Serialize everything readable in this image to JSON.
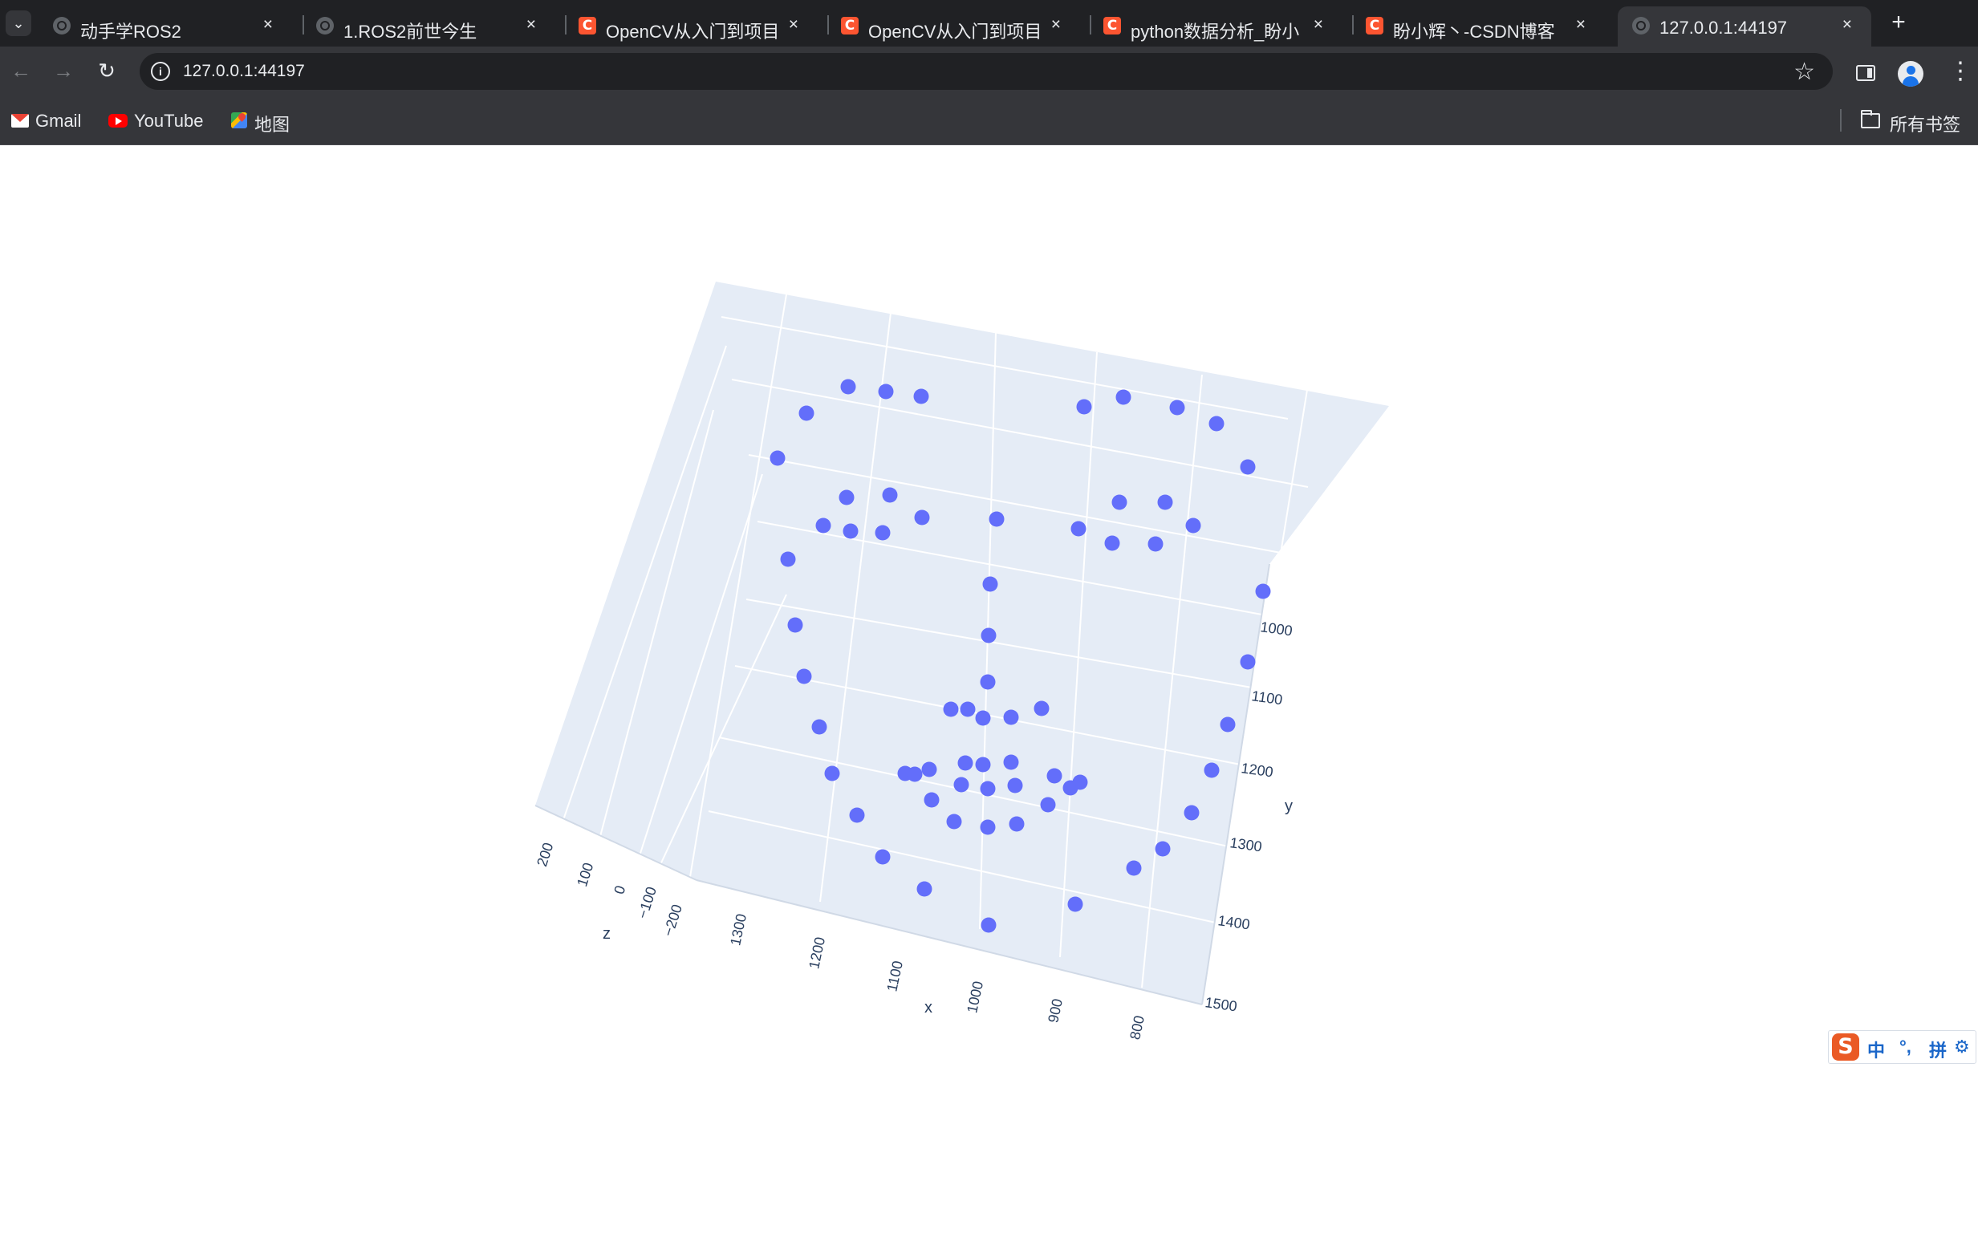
{
  "browser": {
    "tabs": [
      {
        "title": "动手学ROS2",
        "icon": "globe-icon",
        "active": false
      },
      {
        "title": "1.ROS2前世今生",
        "icon": "globe-icon",
        "active": false
      },
      {
        "title": "OpenCV从入门到项目",
        "icon": "csdn-icon",
        "active": false
      },
      {
        "title": "OpenCV从入门到项目",
        "icon": "csdn-icon",
        "active": false
      },
      {
        "title": "python数据分析_盼小",
        "icon": "csdn-icon",
        "active": false
      },
      {
        "title": "盼小辉丶-CSDN博客",
        "icon": "csdn-icon",
        "active": false
      },
      {
        "title": "127.0.0.1:44197",
        "icon": "globe-icon",
        "active": true
      }
    ],
    "tab_close_glyph": "×",
    "csdn_letter": "C",
    "new_tab_glyph": "+",
    "tab_search_glyph": "⌄",
    "address": "127.0.0.1:44197",
    "site_info_glyph": "i",
    "nav": {
      "back": "←",
      "forward": "→",
      "reload": "↻",
      "bookmark_star": "☆",
      "menu": "⋮"
    },
    "bookmarks": [
      {
        "label": "Gmail",
        "icon": "gmail-icon"
      },
      {
        "label": "YouTube",
        "icon": "youtube-icon"
      },
      {
        "label": "地图",
        "icon": "maps-icon"
      }
    ],
    "all_bookmarks": "所有书签",
    "colors": {
      "tabstrip": "#202124",
      "toolbar": "#35363a",
      "text": "#e8eaed",
      "csdn": "#fc5531"
    }
  },
  "chart_data": {
    "type": "scatter",
    "mode": "3d",
    "title": "",
    "marker_color": "#636efa",
    "scene_background": "#e5ecf6",
    "axes": {
      "x": {
        "label": "x",
        "ticks": [
          "1300",
          "1200",
          "1100",
          "1000",
          "900",
          "800"
        ]
      },
      "y": {
        "label": "y",
        "ticks": [
          "1000",
          "1100",
          "1200",
          "1300",
          "1400",
          "1500"
        ]
      },
      "z": {
        "label": "z",
        "ticks": [
          "200",
          "100",
          "0",
          "−100",
          "−200"
        ]
      }
    },
    "point_count": 68
  },
  "ime": {
    "logo": "S",
    "lang": "中",
    "punct": "°,",
    "mode": "拼",
    "settings": "⚙"
  }
}
